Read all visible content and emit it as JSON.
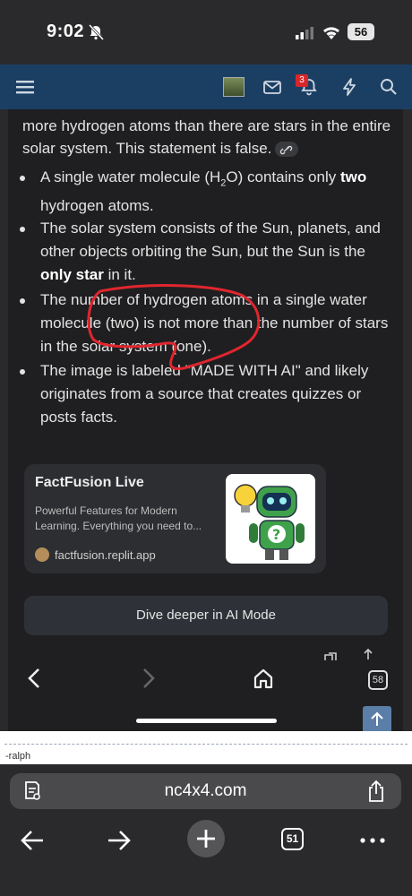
{
  "status_bar": {
    "time": "9:02",
    "battery": "56"
  },
  "forum_header": {
    "notification_count": "3"
  },
  "article": {
    "intro_text": "more hydrogen atoms than there are stars in the entire solar system. This statement is false.",
    "bullets": [
      {
        "parts": [
          "A single water molecule (H",
          "2",
          "O) contains only ",
          "two",
          " hydrogen atoms."
        ]
      },
      {
        "parts": [
          "The solar system consists of the Sun, planets, and other objects orbiting the Sun, but the Sun is the ",
          "only star",
          " in it."
        ]
      },
      {
        "text": "The number of hydrogen atoms in a single water molecule (two) is not more than the number of stars in the solar system (one)."
      },
      {
        "text": "The image is labeled \"MADE WITH AI\" and likely originates from a source that creates quizzes or posts facts."
      }
    ]
  },
  "source_card": {
    "title": "FactFusion Live",
    "description": "Powerful Features for Modern Learning. Everything you need to...",
    "site": "factfusion.replit.app",
    "more_icon": "⋮"
  },
  "dive_button": {
    "label": "Dive deeper in AI Mode"
  },
  "inner_browser": {
    "tab_count": "58"
  },
  "post_caption": "-ralph",
  "safari": {
    "url": "nc4x4.com",
    "tab_count": "51"
  },
  "colors": {
    "forum_header": "#1b3f63",
    "annotation": "#e0262e",
    "scroll_top": "#5b7ea8"
  }
}
